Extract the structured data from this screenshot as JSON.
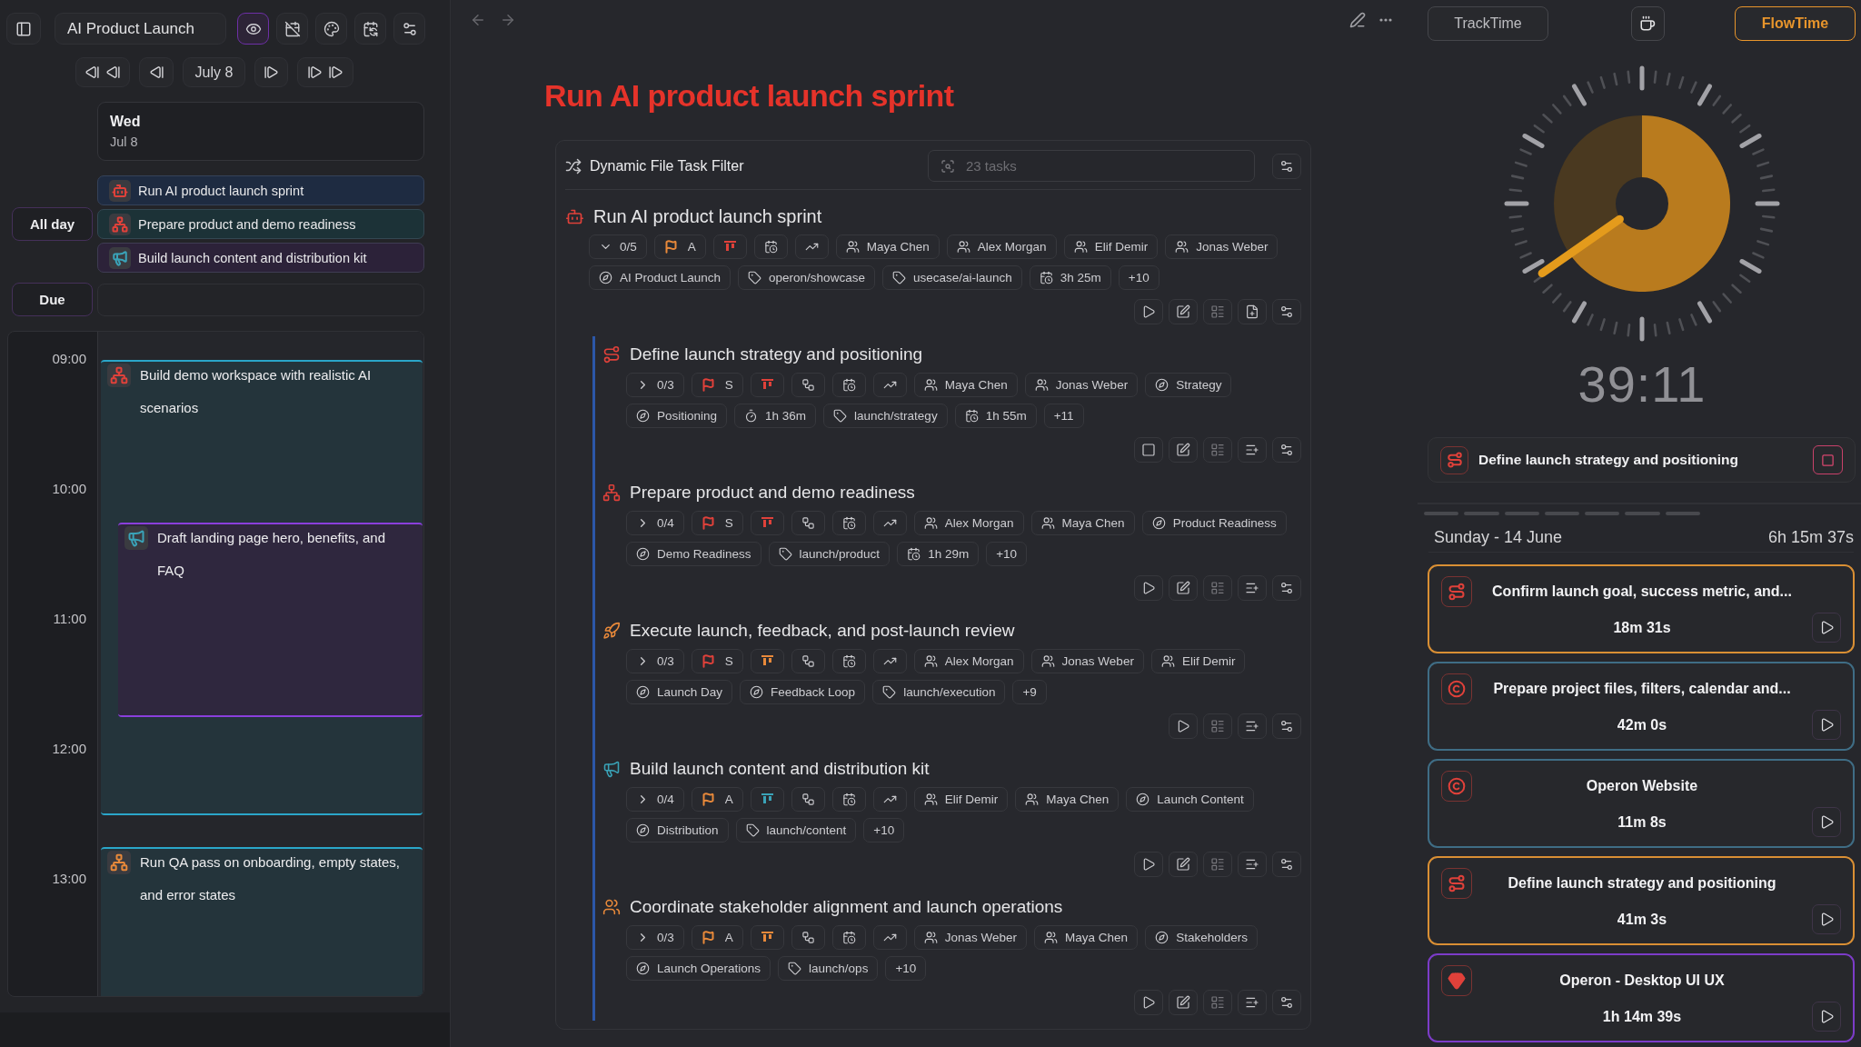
{
  "left_panel": {
    "toolbar": {
      "project": "AI Product Launch",
      "view_buttons": [
        {
          "kind": "eye",
          "selected": true
        },
        {
          "kind": "calendar-off",
          "selected": false
        },
        {
          "kind": "palette",
          "selected": false
        },
        {
          "kind": "calendar-sync",
          "selected": false
        },
        {
          "kind": "sliders",
          "selected": false
        }
      ]
    },
    "date_nav": {
      "label": "July 8"
    },
    "day": {
      "weekday": "Wed",
      "date": "Jul 8"
    },
    "all_day": {
      "label": "All day",
      "events": [
        {
          "title": "Run AI product launch sprint",
          "color": "#1e2b41",
          "icon": {
            "kind": "bot",
            "color": "#e0413a"
          }
        },
        {
          "title": "Prepare product and demo readiness",
          "color": "#1c3237",
          "icon": {
            "kind": "network",
            "color": "#e0413a"
          }
        },
        {
          "title": "Build launch content and distribution kit",
          "color": "#2c2239",
          "icon": {
            "kind": "megaphone",
            "color": "#3aa3b8"
          }
        }
      ]
    },
    "due": {
      "label": "Due"
    },
    "timeline": {
      "hours": [
        "09:00",
        "10:00",
        "11:00",
        "12:00",
        "13:00"
      ],
      "events": [
        {
          "title": "Build demo workspace with realistic AI scenarios",
          "color": "#2aa6c9",
          "icon": {
            "kind": "network",
            "color": "#e0413a"
          }
        },
        {
          "title": "Draft landing page hero, benefits, and FAQ",
          "color": "#8a3fdc",
          "icon": {
            "kind": "megaphone",
            "color": "#3aa3b8"
          }
        },
        {
          "title": "Run QA pass on onboarding, empty states, and error states",
          "color": "#2aa6c9",
          "icon": {
            "kind": "network",
            "color": "#e8893a"
          }
        }
      ]
    }
  },
  "editor": {
    "title": "Run AI product launch sprint",
    "filter": {
      "title": "Dynamic File Task Filter",
      "placeholder": "23 tasks"
    },
    "tasks": [
      {
        "title": "Run AI product launch sprint",
        "icon": {
          "kind": "bot",
          "color": "#e0413a"
        },
        "chip_rows": [
          [
            {
              "kind": "subtasks",
              "text": "0/5",
              "expanded": true
            },
            {
              "kind": "priority",
              "text": "A",
              "color": "#e8893a"
            },
            {
              "kind": "status",
              "color": "#e0413a"
            },
            {
              "kind": "schedule"
            },
            {
              "kind": "trend"
            },
            {
              "kind": "person",
              "text": "Maya Chen"
            },
            {
              "kind": "person",
              "text": "Alex Morgan"
            },
            {
              "kind": "person",
              "text": "Elif Demir"
            },
            {
              "kind": "person",
              "text": "Jonas Weber"
            }
          ],
          [
            {
              "kind": "project",
              "text": "AI Product Launch"
            },
            {
              "kind": "tag",
              "text": "operon/showcase"
            },
            {
              "kind": "tag",
              "text": "usecase/ai-launch"
            },
            {
              "kind": "estimate",
              "text": "3h 25m"
            },
            {
              "kind": "more",
              "text": "+10"
            }
          ]
        ],
        "actions": [
          {
            "kind": "play"
          },
          {
            "kind": "edit"
          },
          {
            "kind": "board"
          },
          {
            "kind": "add-file"
          },
          {
            "kind": "options"
          }
        ],
        "children": [
          {
            "title": "Define launch strategy and positioning",
            "icon": {
              "kind": "route",
              "color": "#e0413a"
            },
            "chip_rows": [
              [
                {
                  "kind": "subtasks",
                  "text": "0/3",
                  "expanded": false
                },
                {
                  "kind": "priority",
                  "text": "S",
                  "color": "#e0413a"
                },
                {
                  "kind": "status",
                  "color": "#e0413a"
                },
                {
                  "kind": "dependency"
                },
                {
                  "kind": "schedule"
                },
                {
                  "kind": "trend"
                },
                {
                  "kind": "person",
                  "text": "Maya Chen"
                },
                {
                  "kind": "person",
                  "text": "Jonas Weber"
                },
                {
                  "kind": "project",
                  "text": "Strategy"
                }
              ],
              [
                {
                  "kind": "project",
                  "text": "Positioning"
                },
                {
                  "kind": "timer",
                  "text": "1h 36m"
                },
                {
                  "kind": "tag",
                  "text": "launch/strategy"
                },
                {
                  "kind": "estimate",
                  "text": "1h 55m"
                },
                {
                  "kind": "more",
                  "text": "+11"
                }
              ]
            ],
            "actions": [
              {
                "kind": "stop"
              },
              {
                "kind": "edit"
              },
              {
                "kind": "board"
              },
              {
                "kind": "add-list"
              },
              {
                "kind": "options"
              }
            ]
          },
          {
            "title": "Prepare product and demo readiness",
            "icon": {
              "kind": "network",
              "color": "#e0413a"
            },
            "chip_rows": [
              [
                {
                  "kind": "subtasks",
                  "text": "0/4",
                  "expanded": false
                },
                {
                  "kind": "priority",
                  "text": "S",
                  "color": "#e0413a"
                },
                {
                  "kind": "status",
                  "color": "#e0413a"
                },
                {
                  "kind": "dependency"
                },
                {
                  "kind": "schedule"
                },
                {
                  "kind": "trend"
                },
                {
                  "kind": "person",
                  "text": "Alex Morgan"
                },
                {
                  "kind": "person",
                  "text": "Maya Chen"
                },
                {
                  "kind": "project",
                  "text": "Product Readiness"
                }
              ],
              [
                {
                  "kind": "project",
                  "text": "Demo Readiness"
                },
                {
                  "kind": "tag",
                  "text": "launch/product"
                },
                {
                  "kind": "estimate",
                  "text": "1h 29m"
                },
                {
                  "kind": "more",
                  "text": "+10"
                }
              ]
            ],
            "actions": [
              {
                "kind": "play"
              },
              {
                "kind": "edit"
              },
              {
                "kind": "board"
              },
              {
                "kind": "add-list"
              },
              {
                "kind": "options"
              }
            ]
          },
          {
            "title": "Execute launch, feedback, and post-launch review",
            "icon": {
              "kind": "rocket",
              "color": "#e8893a"
            },
            "chip_rows": [
              [
                {
                  "kind": "subtasks",
                  "text": "0/3",
                  "expanded": false
                },
                {
                  "kind": "priority",
                  "text": "S",
                  "color": "#e0413a"
                },
                {
                  "kind": "status",
                  "color": "#e8893a"
                },
                {
                  "kind": "dependency"
                },
                {
                  "kind": "schedule"
                },
                {
                  "kind": "trend"
                },
                {
                  "kind": "person",
                  "text": "Alex Morgan"
                },
                {
                  "kind": "person",
                  "text": "Jonas Weber"
                },
                {
                  "kind": "person",
                  "text": "Elif Demir"
                }
              ],
              [
                {
                  "kind": "project",
                  "text": "Launch Day"
                },
                {
                  "kind": "project",
                  "text": "Feedback Loop"
                },
                {
                  "kind": "tag",
                  "text": "launch/execution"
                },
                {
                  "kind": "more",
                  "text": "+9"
                }
              ]
            ],
            "actions": [
              {
                "kind": "play"
              },
              {
                "kind": "board"
              },
              {
                "kind": "add-list"
              },
              {
                "kind": "options"
              }
            ]
          },
          {
            "title": "Build launch content and distribution kit",
            "icon": {
              "kind": "megaphone",
              "color": "#3aa3b8"
            },
            "chip_rows": [
              [
                {
                  "kind": "subtasks",
                  "text": "0/4",
                  "expanded": false
                },
                {
                  "kind": "priority",
                  "text": "A",
                  "color": "#e8893a"
                },
                {
                  "kind": "status",
                  "color": "#3aa3b8"
                },
                {
                  "kind": "dependency"
                },
                {
                  "kind": "schedule"
                },
                {
                  "kind": "trend"
                },
                {
                  "kind": "person",
                  "text": "Elif Demir"
                },
                {
                  "kind": "person",
                  "text": "Maya Chen"
                },
                {
                  "kind": "project",
                  "text": "Launch Content"
                }
              ],
              [
                {
                  "kind": "project",
                  "text": "Distribution"
                },
                {
                  "kind": "tag",
                  "text": "launch/content"
                },
                {
                  "kind": "more",
                  "text": "+10"
                }
              ]
            ],
            "actions": [
              {
                "kind": "play"
              },
              {
                "kind": "edit"
              },
              {
                "kind": "board"
              },
              {
                "kind": "add-list"
              },
              {
                "kind": "options"
              }
            ]
          },
          {
            "title": "Coordinate stakeholder alignment and launch operations",
            "icon": {
              "kind": "users",
              "color": "#e8893a"
            },
            "chip_rows": [
              [
                {
                  "kind": "subtasks",
                  "text": "0/3",
                  "expanded": false
                },
                {
                  "kind": "priority",
                  "text": "A",
                  "color": "#e8893a"
                },
                {
                  "kind": "status",
                  "color": "#e8893a"
                },
                {
                  "kind": "dependency"
                },
                {
                  "kind": "schedule"
                },
                {
                  "kind": "trend"
                },
                {
                  "kind": "person",
                  "text": "Jonas Weber"
                },
                {
                  "kind": "person",
                  "text": "Maya Chen"
                },
                {
                  "kind": "project",
                  "text": "Stakeholders"
                }
              ],
              [
                {
                  "kind": "project",
                  "text": "Launch Operations"
                },
                {
                  "kind": "tag",
                  "text": "launch/ops"
                },
                {
                  "kind": "more",
                  "text": "+10"
                }
              ]
            ],
            "actions": [
              {
                "kind": "play"
              },
              {
                "kind": "edit"
              },
              {
                "kind": "board"
              },
              {
                "kind": "add-list"
              },
              {
                "kind": "options"
              }
            ]
          }
        ]
      }
    ]
  },
  "timer": {
    "modes": [
      {
        "label": "TrackTime",
        "selected": false
      },
      {
        "label": "FlowTime",
        "selected": true
      }
    ],
    "clock": {
      "reading": "39:11"
    },
    "current": {
      "title": "Define launch strategy and positioning",
      "icon": {
        "kind": "route",
        "color": "#e0413a"
      },
      "running": true
    }
  },
  "history": {
    "date": "Sunday - 14 June",
    "total": "6h 15m 37s",
    "sessions": [
      {
        "title": "Confirm launch goal, success metric, and...",
        "duration": "18m 31s",
        "color": "#d98f34",
        "icon": {
          "kind": "route",
          "color": "#e0413a"
        }
      },
      {
        "title": "Prepare project files, filters, calendar and...",
        "duration": "42m 0s",
        "color": "#3f6d85",
        "icon": {
          "kind": "copyright",
          "color": "#e0413a"
        }
      },
      {
        "title": "Operon Website",
        "duration": "11m 8s",
        "color": "#3f6d85",
        "icon": {
          "kind": "copyright",
          "color": "#e0413a"
        }
      },
      {
        "title": "Define launch strategy and positioning",
        "duration": "41m 3s",
        "color": "#d98f34",
        "icon": {
          "kind": "route",
          "color": "#e0413a"
        }
      },
      {
        "title": "Operon - Desktop UI UX",
        "duration": "1h 14m 39s",
        "color": "#7c3cc8",
        "icon": {
          "kind": "gem",
          "color": "#e0413a"
        }
      }
    ]
  }
}
